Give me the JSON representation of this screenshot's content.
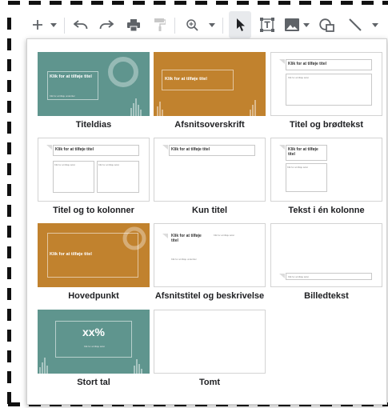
{
  "toolbar": {
    "items": [
      {
        "name": "new-slide-button",
        "icon": "plus-icon"
      },
      {
        "name": "new-slide-dropdown",
        "icon": "chevron-down-icon"
      },
      {
        "name": "undo-button",
        "icon": "undo-icon"
      },
      {
        "name": "redo-button",
        "icon": "redo-icon"
      },
      {
        "name": "print-button",
        "icon": "print-icon"
      },
      {
        "name": "paint-format-button",
        "icon": "paint-roller-icon"
      },
      {
        "name": "zoom-button",
        "icon": "zoom-icon"
      },
      {
        "name": "select-button",
        "icon": "cursor-icon"
      },
      {
        "name": "textbox-button",
        "icon": "textbox-icon"
      },
      {
        "name": "image-button",
        "icon": "image-icon"
      },
      {
        "name": "shape-button",
        "icon": "shape-icon"
      },
      {
        "name": "line-button",
        "icon": "line-icon"
      }
    ]
  },
  "layouts": [
    {
      "label": "Titeldias",
      "title": "Klik for at tilføje titel",
      "sub": "Klik for at tilføje undertitel"
    },
    {
      "label": "Afsnitsoverskrift",
      "title": "Klik for at tilføje titel"
    },
    {
      "label": "Titel og brødtekst",
      "title": "Klik for at tilføje titel",
      "body": "Klik for at tilføje tekst"
    },
    {
      "label": "Titel og to kolonner",
      "title": "Klik for at tilføje titel",
      "body": "Klik for at tilføje tekst",
      "body2": "Klik for at tilføje tekst"
    },
    {
      "label": "Kun titel",
      "title": "Klik for at tilføje titel"
    },
    {
      "label": "Tekst i én kolonne",
      "title": "Klik for at tilføje titel",
      "body": "Klik for at tilføje tekst"
    },
    {
      "label": "Hovedpunkt",
      "title": "Klik for at tilføje titel"
    },
    {
      "label": "Afsnitstitel og beskrivelse",
      "title": "Klik for at tilføje titel",
      "sub": "Klik for at tilføje undertitel",
      "body": "Klik for at tilføje tekst"
    },
    {
      "label": "Billedtekst",
      "body": "Klik for at tilføje tekst"
    },
    {
      "label": "Stort tal",
      "title": "xx%",
      "body": "Klik for at tilføje tekst"
    },
    {
      "label": "Tomt"
    }
  ],
  "colors": {
    "teal": "#5f958e",
    "orange": "#c1822e"
  }
}
